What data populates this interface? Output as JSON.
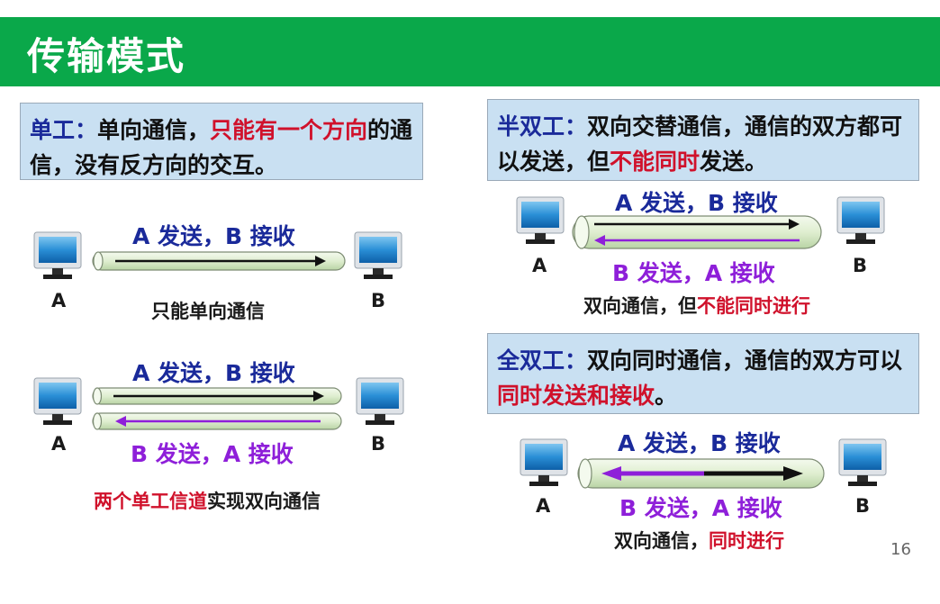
{
  "slide": {
    "title": "传输模式",
    "page_number": "16"
  },
  "simplex": {
    "desc_head": "单工：",
    "desc_mid": "单向通信，",
    "desc_red": "只能有一个方向",
    "desc_tail": "的通信，没有反方向的交互。",
    "arrow_label": "A 发送，B 接收",
    "caption": "只能单向通信",
    "node_a": "A",
    "node_b": "B"
  },
  "dual_simplex": {
    "top_label": "A 发送，B 接收",
    "bottom_label": "B 发送，A 接收",
    "caption_red": "两个单工信道",
    "caption_tail": "实现双向通信",
    "node_a": "A",
    "node_b": "B"
  },
  "half_duplex": {
    "desc_head": "半双工：",
    "desc_mid": "双向交替通信，通信的双方都可以发送，但",
    "desc_red": "不能同时",
    "desc_tail": "发送。",
    "top_label": "A 发送，B 接收",
    "bottom_label": "B 发送，A 接收",
    "caption_head": "双向通信，但",
    "caption_red": "不能同时进行",
    "node_a": "A",
    "node_b": "B"
  },
  "full_duplex": {
    "desc_head": "全双工：",
    "desc_mid": "双向同时通信，通信的双方可以",
    "desc_red": "同时发送和接收",
    "desc_tail": "。",
    "top_label": "A 发送，B 接收",
    "bottom_label": "B 发送，A 接收",
    "caption_head": "双向通信，",
    "caption_red": "同时进行",
    "node_a": "A",
    "node_b": "B"
  },
  "colors": {
    "header_green": "#0aa84a",
    "box_blue": "#c9e0f2",
    "label_blue": "#1a2a9a",
    "highlight_red": "#d0112b",
    "reverse_purple": "#8e1fd9",
    "pipe_green": "#dfeed0"
  }
}
